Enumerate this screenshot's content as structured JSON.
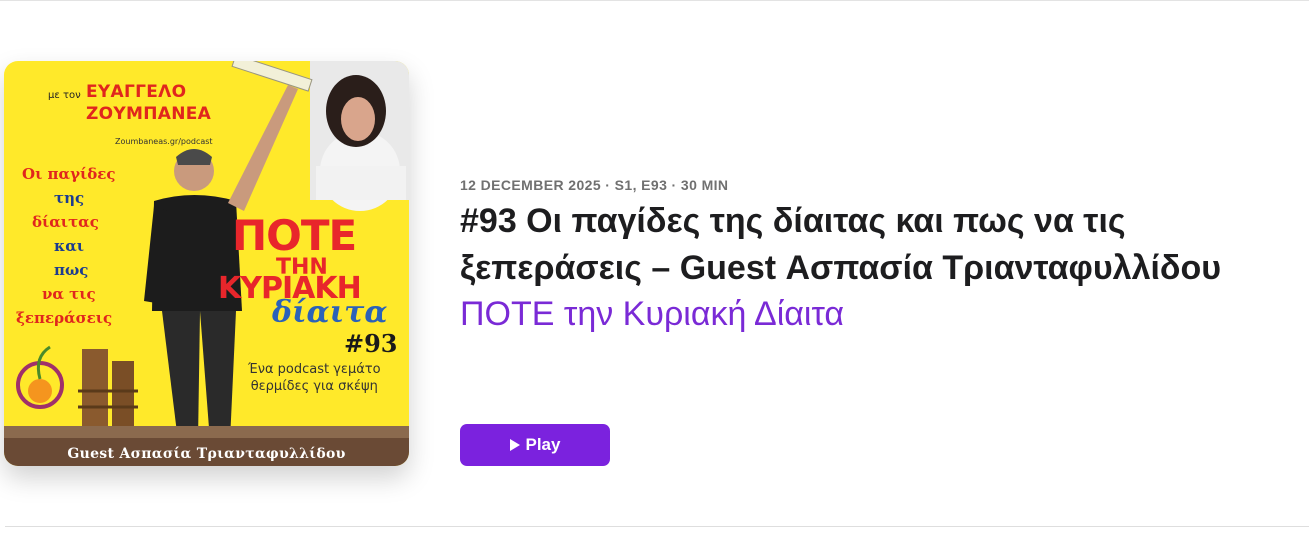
{
  "episode": {
    "meta": "12 DECEMBER 2025 · S1, E93 · 30 MIN",
    "title": "#93 Οι παγίδες της δίαιτας και πως να τις ξεπεράσεις – Guest Ασπασία Τριανταφυλλίδου",
    "show_name": "ΠΟΤΕ την Κυριακή Δίαιτα",
    "play_label": "Play",
    "accent_color": "#7b22de"
  },
  "artwork": {
    "host_prefix": "με τον",
    "host_name_line1": "ΕΥΑΓΓΕΛΟ",
    "host_name_line2": "ΖΟΥΜΠΑΝΕΑ",
    "host_site": "Zoumbaneas.gr/podcast",
    "topic_lines": [
      "Οι παγίδες",
      "της",
      "δίαιτας",
      "και",
      "πως",
      "να τις",
      "ξεπεράσεις"
    ],
    "logo_line1": "ΠΟΤΕ",
    "logo_line2": "ΤΗΝ",
    "logo_line3": "ΚΥΡΙΑΚΗ",
    "logo_line4": "δίαιτα",
    "episode_number": "#93",
    "tagline_line1": "Ένα podcast γεμάτο",
    "tagline_line2": "θερμίδες για σκέψη",
    "guest_label": "Guest Ασπασία Τριανταφυλλίδου",
    "background_color": "#ffe92a"
  }
}
